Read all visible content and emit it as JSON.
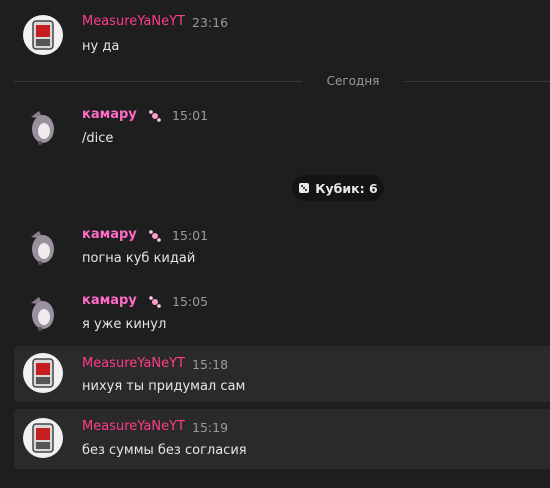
{
  "messages": [
    {
      "author": "MeasureYaNeYT",
      "time": "23:16",
      "text": "ну да"
    },
    {
      "author": "камару",
      "time": "15:01",
      "text": "/dice"
    },
    {
      "author": "камару",
      "time": "15:01",
      "text": "погна куб кидай"
    },
    {
      "author": "камару",
      "time": "15:05",
      "text": "я уже кинул"
    },
    {
      "author": "MeasureYaNeYT",
      "time": "15:18",
      "text": "нихуя ты придумал сам"
    },
    {
      "author": "MeasureYaNeYT",
      "time": "15:19",
      "text": "без суммы без согласия"
    }
  ],
  "date_divider": "Сегодня",
  "dice_result": "Кубик: 6",
  "colors": {
    "background": "#1e1e1e",
    "highlight": "#2a2a2a",
    "measure_name": "#ff3d88",
    "kamaru_name": "#ff6bc6",
    "timestamp": "#9a9a9a"
  },
  "icons": {
    "badge": "candy-badge-icon",
    "dice": "dice-icon"
  }
}
